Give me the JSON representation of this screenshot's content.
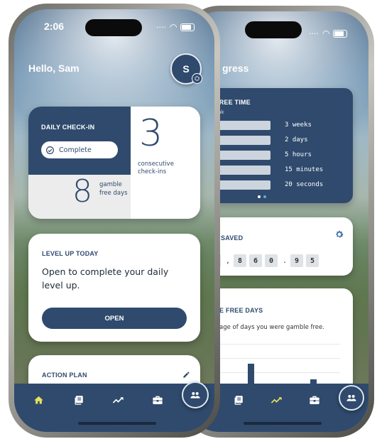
{
  "front": {
    "status": {
      "time": "2:06"
    },
    "greeting": "Hello, Sam",
    "avatar_initial": "S",
    "checkin": {
      "title": "DAILY CHECK-IN",
      "button_label": "Complete",
      "big_number": "3",
      "big_caption": "consecutive check-ins",
      "small_number": "8",
      "small_caption": "gamble free days"
    },
    "level_up": {
      "title": "LEVEL UP TODAY",
      "text": "Open to complete your daily level up.",
      "button": "OPEN"
    },
    "action_plan": {
      "title": "ACTION PLAN"
    }
  },
  "back": {
    "header": "gress",
    "free_time": {
      "title": "FREE TIME",
      "subtitle": "eak",
      "rows": [
        {
          "label": "3 weeks",
          "fill": 0
        },
        {
          "label": "2 days",
          "fill": 0
        },
        {
          "label": "5 hours",
          "fill": 0
        },
        {
          "label": "15 minutes",
          "fill": 0
        },
        {
          "label": "20 seconds",
          "fill": 0.12
        }
      ]
    },
    "saved": {
      "title": "SAVED",
      "digits": [
        "",
        "8",
        "6",
        "0",
        "9",
        "5"
      ],
      "separators": [
        ",",
        "."
      ]
    },
    "free_days": {
      "title": "E FREE DAYS",
      "text": "age of days you were gamble free."
    }
  },
  "colors": {
    "navy": "#2f4a6d",
    "tab_active": "#e7e45a",
    "tab_inactive": "#ffffff"
  }
}
